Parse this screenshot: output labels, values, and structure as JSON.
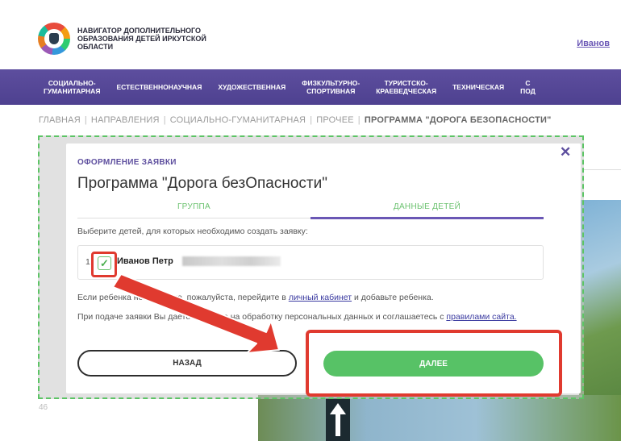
{
  "header": {
    "site_title": "Навигатор дополнительного образования детей Иркутской области",
    "user_link": "Иванов"
  },
  "nav": {
    "items": [
      "Социально-\nгуманитарная",
      "Естественнонаучная",
      "Художественная",
      "Физкультурно-\nспортивная",
      "Туристско-\nкраеведческая",
      "Техническая",
      "С\nпод"
    ]
  },
  "breadcrumb": {
    "items": [
      "Главная",
      "Направления",
      "Социально-гуманитарная",
      "Прочее"
    ],
    "current": "Программа \"Дорога безопасности\""
  },
  "modal": {
    "subtitle": "Оформление заявки",
    "title": "Программа \"Дорога безОпасности\"",
    "tabs": [
      {
        "label": "Группа",
        "active": false
      },
      {
        "label": "Данные детей",
        "active": true
      }
    ],
    "instruction": "Выберите детей, для которых необходимо создать заявку:",
    "children": [
      {
        "number": "1",
        "name": "Иванов Петр",
        "checked": true
      }
    ],
    "note1_start": "Если ребенка нет в списке, пожалуйста, перейдите в ",
    "note1_link": "личный кабинет",
    "note1_end": " и добавьте ребенка.",
    "note2_start": "При подаче заявки Вы даете согласие на обработку персональных данных и соглашаетесь с ",
    "note2_link": "правилами сайта.",
    "back_label": "Назад",
    "next_label": "Далее"
  },
  "page_number": "46",
  "colors": {
    "brand_purple": "#5d4e9e",
    "accent_green": "#57c266",
    "annotation_red": "#e03a2f"
  }
}
